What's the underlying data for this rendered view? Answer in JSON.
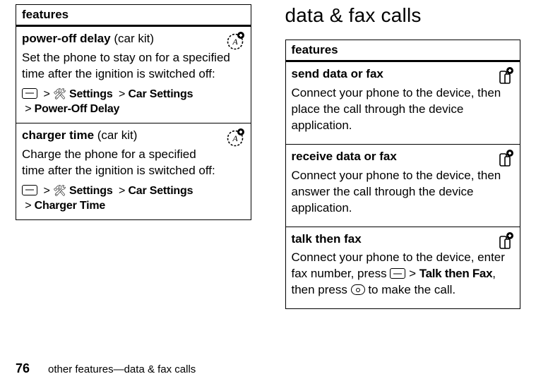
{
  "left": {
    "header": "features",
    "rows": [
      {
        "title_bold": "power-off delay",
        "title_rest": " (car kit)",
        "body": "Set the phone to stay on for a specified time after the ignition is switched off:",
        "nav_settings": "Settings",
        "nav_car": "Car Settings",
        "nav_last": "Power-Off Delay",
        "icon": "A"
      },
      {
        "title_bold": "charger time",
        "title_rest": " (car kit)",
        "body": "Charge the phone for a specified time after the ignition is switched off:",
        "nav_settings": "Settings",
        "nav_car": "Car Settings",
        "nav_last": "Charger Time",
        "icon": "A"
      }
    ]
  },
  "right": {
    "section_title": "data & fax calls",
    "header": "features",
    "rows": [
      {
        "title_bold": "send data or fax",
        "body": "Connect your phone to the device, then place the call through the device application.",
        "icon": "D"
      },
      {
        "title_bold": "receive data or fax",
        "body": "Connect your phone to the device, then answer the call through the device application.",
        "icon": "D"
      },
      {
        "title_bold": "talk then fax",
        "body_pre": "Connect your phone to the device, enter fax number, press ",
        "nav_label": "Talk then Fax",
        "body_mid": ", then press ",
        "body_post": " to make the call.",
        "icon": "D"
      }
    ]
  },
  "footer": {
    "page": "76",
    "text": "other features—data & fax calls"
  },
  "glyphs": {
    "sep": ">"
  }
}
